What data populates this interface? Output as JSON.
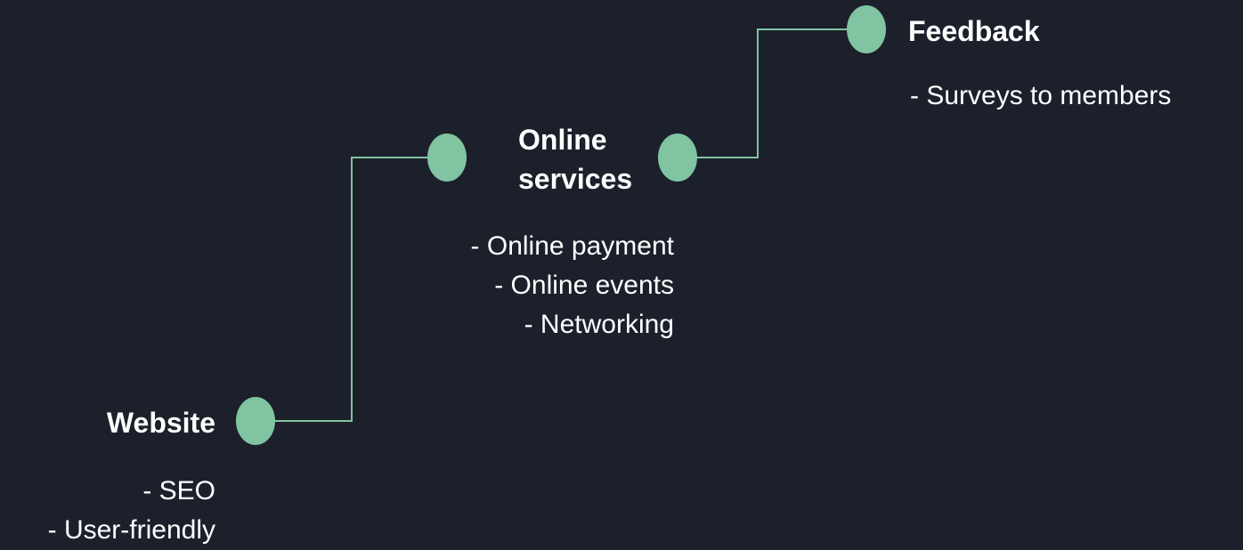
{
  "stages": [
    {
      "title": "Website",
      "items": [
        "- SEO",
        "- User-friendly"
      ]
    },
    {
      "title_lines": [
        "Online",
        "services"
      ],
      "items": [
        "- Online payment",
        "- Online events",
        "- Networking"
      ]
    },
    {
      "title": "Feedback",
      "items": [
        "- Surveys to members"
      ]
    }
  ],
  "colors": {
    "background": "#1c202b",
    "accent": "#80c4a1",
    "text": "#ffffff"
  }
}
